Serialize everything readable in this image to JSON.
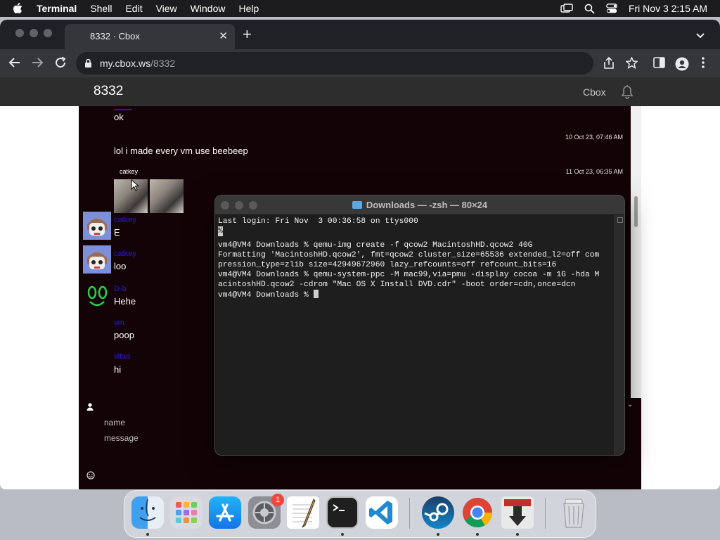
{
  "menubar": {
    "app": "Terminal",
    "items": [
      "Shell",
      "Edit",
      "View",
      "Window",
      "Help"
    ],
    "clock": "Fri Nov 3  2:15 AM"
  },
  "browser": {
    "tab_title": "8332 · Cbox",
    "url_host": "my.cbox.ws",
    "url_path": "/8332"
  },
  "site": {
    "title": "8332",
    "link": "Cbox"
  },
  "chat": {
    "messages": [
      {
        "text": "ok"
      },
      {
        "text": "lol i made every vm use beebeep",
        "time": "10 Oct 23, 07:46 AM"
      },
      {
        "author": "catkey",
        "time": "11 Oct 23, 06:35 AM"
      },
      {
        "author": "catkey",
        "text": "E"
      },
      {
        "author": "catkey",
        "text": "loo"
      },
      {
        "author": "D-b",
        "text": "Hehe"
      },
      {
        "author": "vm",
        "text": "poop"
      },
      {
        "author": "vitaa",
        "text": "hi"
      }
    ],
    "compose": {
      "name_placeholder": "name",
      "message_placeholder": "message"
    }
  },
  "terminal": {
    "title": "Downloads — -zsh — 80×24",
    "lines": [
      "Last login: Fri Nov  3 00:36:58 on ttys000",
      "%",
      "vm4@VM4 Downloads % qemu-img create -f qcow2 MacintoshHD.qcow2 40G",
      "Formatting 'MacintoshHD.qcow2', fmt=qcow2 cluster_size=65536 extended_l2=off com",
      "pression_type=zlib size=42949672960 lazy_refcounts=off refcount_bits=16",
      "vm4@VM4 Downloads % qemu-system-ppc -M mac99,via=pmu -display cocoa -m 1G -hda M",
      "acintoshHD.qcow2 -cdrom \"Mac OS X Install DVD.cdr\" -boot order=cdn,once=dcn",
      "vm4@VM4 Downloads % "
    ]
  },
  "dock": {
    "items": [
      "Finder",
      "Launchpad",
      "App Store",
      "System Settings",
      "TextEdit",
      "Terminal",
      "Visual Studio Code",
      "Steam",
      "Google Chrome",
      "Downloader",
      "Trash"
    ],
    "settings_badge": "1"
  },
  "colors": {
    "chat_bg": "#140306",
    "author_blue": "#2a1ad0",
    "terminal_bg": "#1e1e1e"
  }
}
